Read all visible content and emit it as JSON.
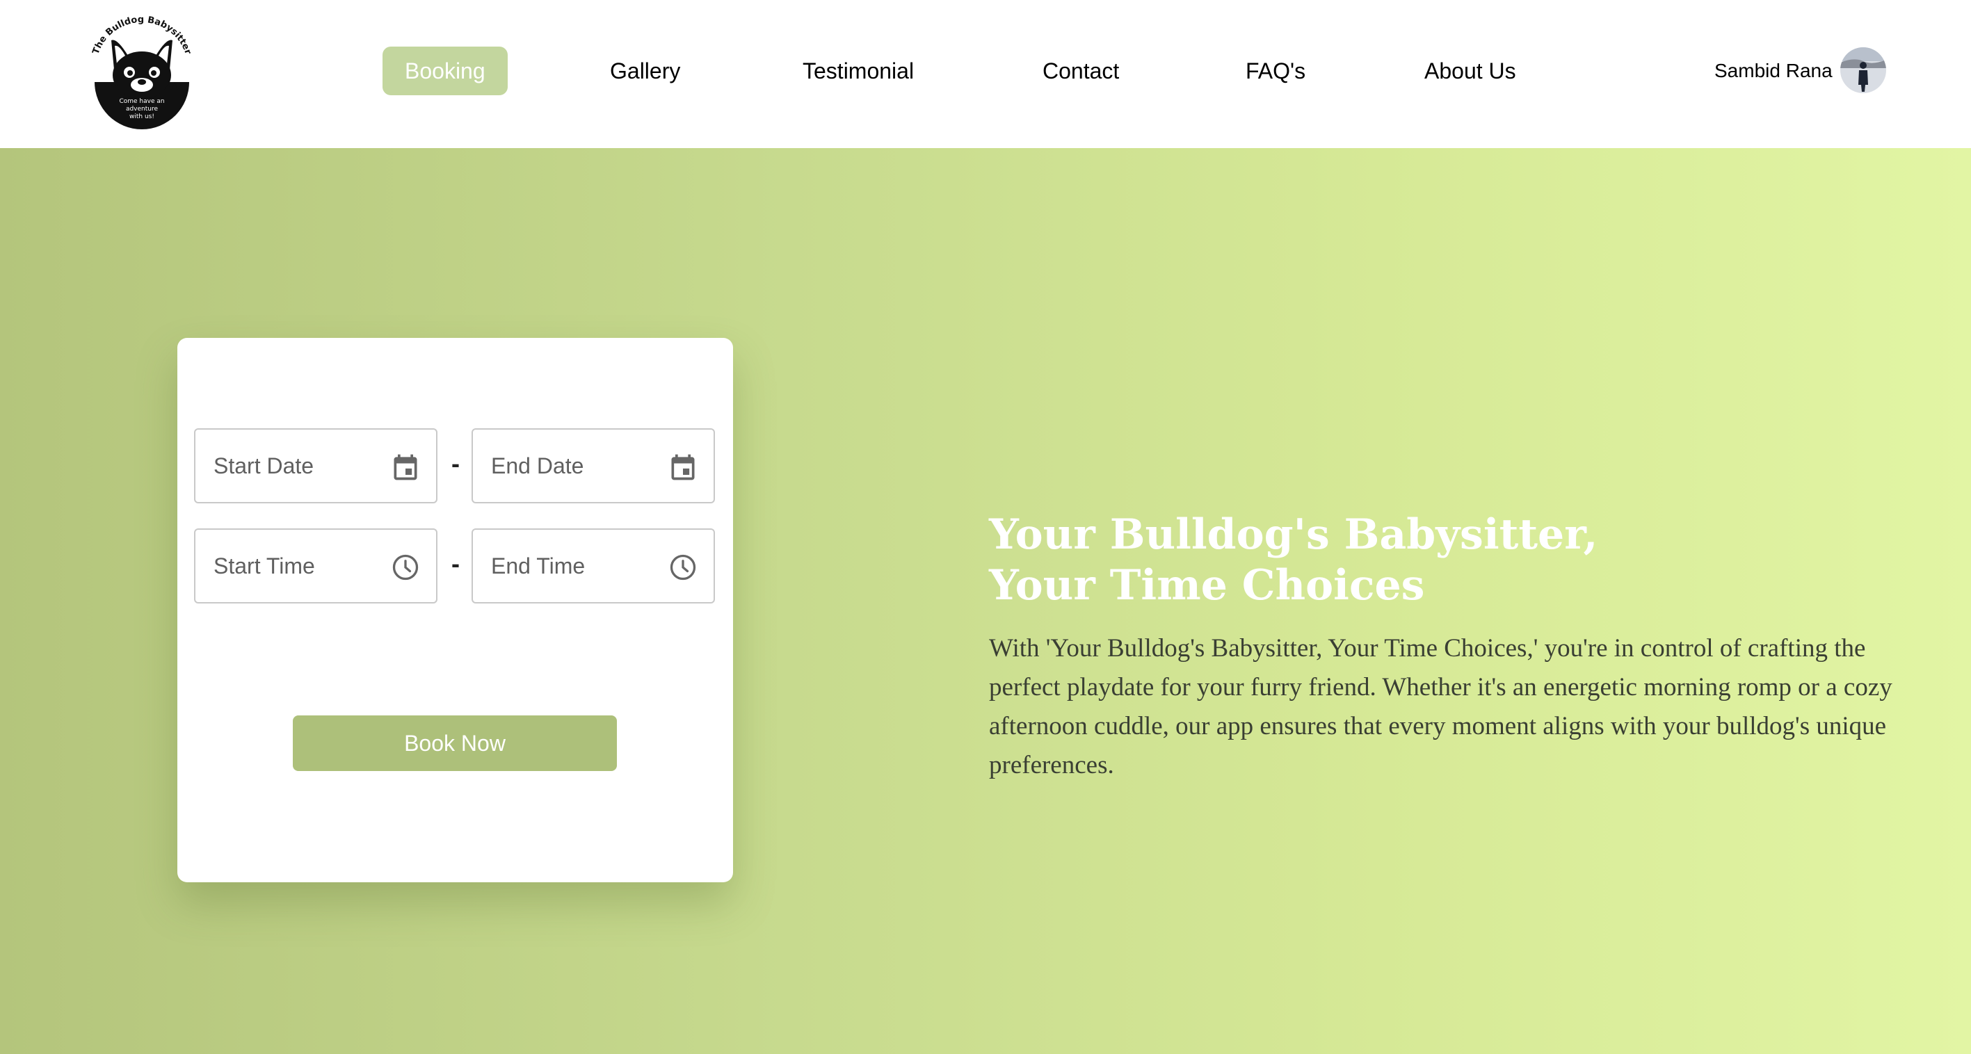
{
  "header": {
    "logo": {
      "arc_text": "The Bulldog Babysitter",
      "tagline_lines": [
        "Come have an",
        "adventure",
        "with us!"
      ],
      "icon": "bulldog-logo-icon"
    },
    "nav": [
      {
        "label": "Booking",
        "active": true
      },
      {
        "label": "Gallery",
        "active": false
      },
      {
        "label": "Testimonial",
        "active": false
      },
      {
        "label": "Contact",
        "active": false
      },
      {
        "label": "FAQ's",
        "active": false
      },
      {
        "label": "About Us",
        "active": false
      }
    ],
    "user": {
      "name": "Sambid Rana",
      "avatar_icon": "user-avatar-icon"
    }
  },
  "booking": {
    "start_date": {
      "placeholder": "Start Date",
      "value": "",
      "icon": "calendar-icon"
    },
    "end_date": {
      "placeholder": "End Date",
      "value": "",
      "icon": "calendar-icon"
    },
    "start_time": {
      "placeholder": "Start Time",
      "value": "",
      "icon": "clock-icon"
    },
    "end_time": {
      "placeholder": "End Time",
      "value": "",
      "icon": "clock-icon"
    },
    "separator": "-",
    "submit_label": "Book Now"
  },
  "hero": {
    "title_line1": "Your Bulldog's Babysitter,",
    "title_line2": "Your Time Choices",
    "description": "With 'Your Bulldog's Babysitter, Your Time Choices,' you're in control of crafting the perfect playdate for your furry friend. Whether it's an energetic morning romp or a cozy afternoon cuddle, our app ensures that every moment aligns with your bulldog's unique preferences."
  },
  "colors": {
    "accent_active_nav": "#c3d69e",
    "button": "#adc07a",
    "gradient_start": "#b4c57c",
    "gradient_end": "#e2f5a4",
    "title_text": "#ffffff",
    "body_text": "#3a3f33"
  }
}
